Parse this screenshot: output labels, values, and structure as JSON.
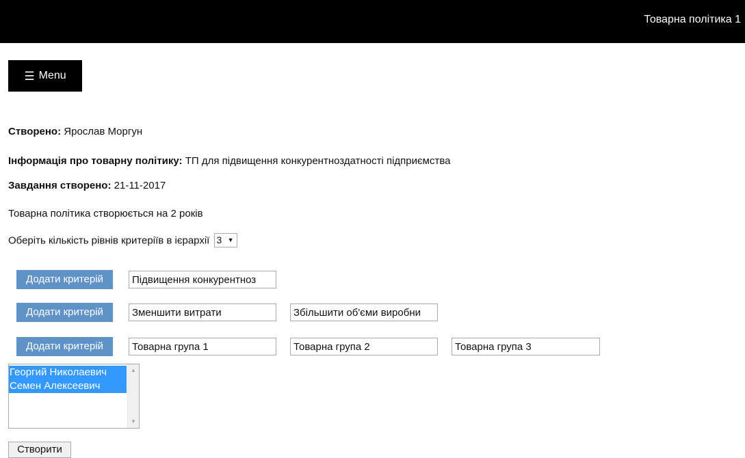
{
  "header": {
    "title": "Товарна політика 1"
  },
  "menu": {
    "icon": "hamburger-icon",
    "label": "Menu"
  },
  "info": {
    "created_by_label": "Створено:",
    "created_by_value": "Ярослав Моргун",
    "policy_info_label": "Інформація про товарну політику:",
    "policy_info_value": "ТП для підвищення конкурентноздатності підприємства",
    "task_created_label": "Завдання створено:",
    "task_created_value": "21-11-2017",
    "duration_text": "Товарна політика створюється на 2 років"
  },
  "levels": {
    "label": "Оберіть кількість рівнів критеріїв в ієрархії",
    "selected": "3"
  },
  "criteria": {
    "add_label": "Додати критерій",
    "level1": [
      "Підвищення конкурентноз"
    ],
    "level2": [
      "Зменшити витрати",
      "Збільшити об'єми виробни"
    ],
    "level3": [
      "Товарна група 1",
      "Товарна група 2",
      "Товарна група 3"
    ]
  },
  "experts": {
    "options": [
      "Георгий Николаевич",
      "Семен Алексеевич"
    ]
  },
  "actions": {
    "create_label": "Створити"
  },
  "colors": {
    "topbar": "#000000",
    "add_button": "#5f93c8",
    "selection": "#3399ff"
  }
}
